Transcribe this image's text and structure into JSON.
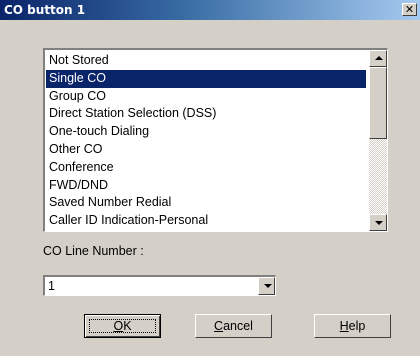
{
  "window": {
    "title": "CO button  1",
    "close_glyph": "✕"
  },
  "list": {
    "items": [
      "Not Stored",
      "Single CO",
      "Group CO",
      "Direct Station Selection (DSS)",
      "One-touch Dialing",
      "Other CO",
      "Conference",
      "FWD/DND",
      "Saved Number Redial",
      "Caller ID Indication-Personal"
    ],
    "selected_index": 1
  },
  "co_line": {
    "label": "CO Line Number :",
    "value": "1"
  },
  "buttons": {
    "ok": {
      "accel": "O",
      "rest": "K"
    },
    "cancel": {
      "accel": "C",
      "rest": "ancel"
    },
    "help": {
      "accel": "H",
      "rest": "elp"
    }
  },
  "colors": {
    "selection_bg": "#0a246a",
    "dialog_bg": "#d4d0c8"
  },
  "icons": {
    "close": "close-icon",
    "scroll_up": "arrow-up-icon",
    "scroll_down": "arrow-down-icon",
    "dropdown": "chevron-down-icon"
  }
}
